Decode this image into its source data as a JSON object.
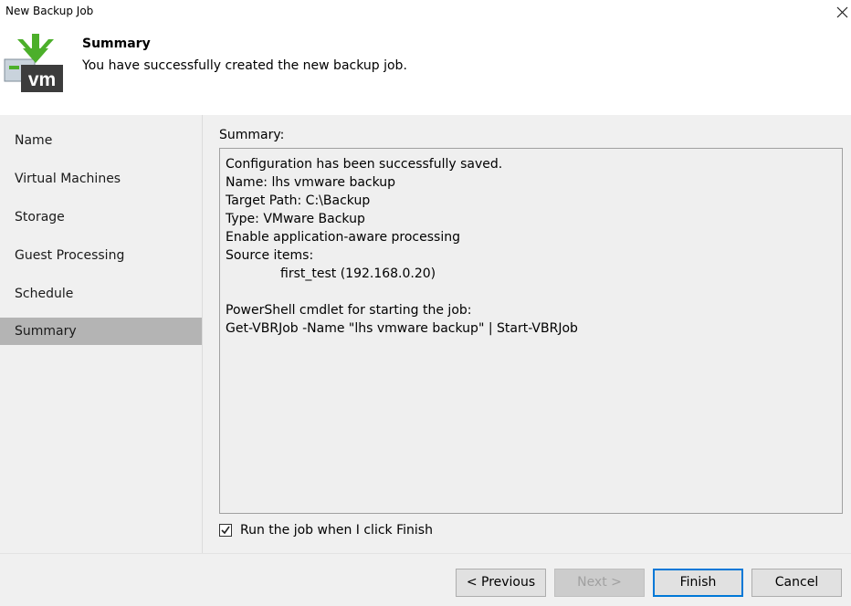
{
  "window": {
    "title": "New Backup Job",
    "close_icon": "close-icon"
  },
  "header": {
    "heading": "Summary",
    "subheading": "You have successfully created the new backup job.",
    "logo_icon": "vm-backup-icon",
    "logo_text": "vm"
  },
  "sidebar": {
    "items": [
      {
        "label": "Name"
      },
      {
        "label": "Virtual Machines"
      },
      {
        "label": "Storage"
      },
      {
        "label": "Guest Processing"
      },
      {
        "label": "Schedule"
      },
      {
        "label": "Summary"
      }
    ],
    "active_index": 5
  },
  "main": {
    "summary_label": "Summary:",
    "summary_lines": {
      "line1": "Configuration has been successfully saved.",
      "line2": "Name: lhs vmware backup",
      "line3": "Target Path: C:\\Backup",
      "line4": "Type: VMware Backup",
      "line5": "Enable application-aware processing",
      "line6": "Source items:",
      "line7": "first_test (192.168.0.20)",
      "line8": "PowerShell cmdlet for starting the job:",
      "line9": "Get-VBRJob -Name \"lhs vmware backup\" | Start-VBRJob"
    },
    "run_job_checkbox": {
      "label": "Run the job when I click Finish",
      "checked": true
    }
  },
  "footer": {
    "previous_label": "< Previous",
    "next_label": "Next >",
    "finish_label": "Finish",
    "cancel_label": "Cancel"
  },
  "colors": {
    "accent": "#0078d7",
    "arrow_green": "#4caf2a",
    "vm_dark": "#3c3c3c",
    "active_sidebar": "#b4b4b4"
  }
}
